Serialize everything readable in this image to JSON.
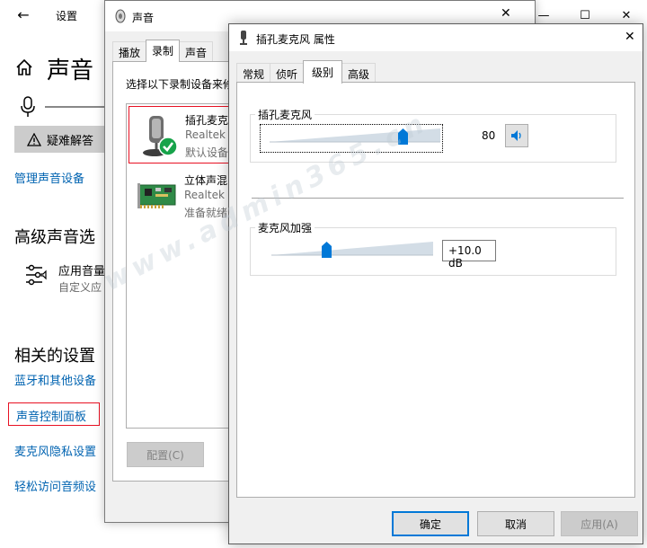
{
  "settings": {
    "back_glyph": "←",
    "title": "设置",
    "controls": {
      "minimize": "—",
      "maximize": "☐",
      "close": "✕"
    },
    "heading": "声音",
    "troubleshoot_label": "疑难解答",
    "manage_devices_link": "管理声音设备",
    "advanced_heading": "高级声音选",
    "app_volume_title": "应用音量",
    "app_volume_sub": "自定义应",
    "related_heading": "相关的设置",
    "related_links": [
      "蓝牙和其他设备",
      "声音控制面板",
      "麦克风隐私设置",
      "轻松访问音频设"
    ]
  },
  "sound_dialog": {
    "title": "声音",
    "close_glyph": "✕",
    "tabs": [
      "播放",
      "录制",
      "声音"
    ],
    "active_tab": 1,
    "instruction": "选择以下录制设备来修",
    "devices": [
      {
        "name": "插孔麦克",
        "line2": "Realtek",
        "line3": "默认设备"
      },
      {
        "name": "立体声混",
        "line2": "Realtek",
        "line3": "准备就绪"
      }
    ],
    "configure_label": "配置(C)"
  },
  "properties_dialog": {
    "title": "插孔麦克风 属性",
    "close_glyph": "✕",
    "tabs": [
      "常规",
      "侦听",
      "级别",
      "高级"
    ],
    "active_tab": 2,
    "mic_group": {
      "label": "插孔麦克风",
      "value": "80",
      "level_fraction": 0.8
    },
    "boost_group": {
      "label": "麦克风加强",
      "value": "+10.0 dB",
      "level_fraction": 0.33
    },
    "buttons": {
      "ok": "确定",
      "cancel": "取消",
      "apply": "应用(A)"
    }
  },
  "watermark": "www.admin365.cn",
  "colors": {
    "accent": "#0078d7",
    "link": "#0063b1",
    "highlight_border": "#e81123"
  }
}
